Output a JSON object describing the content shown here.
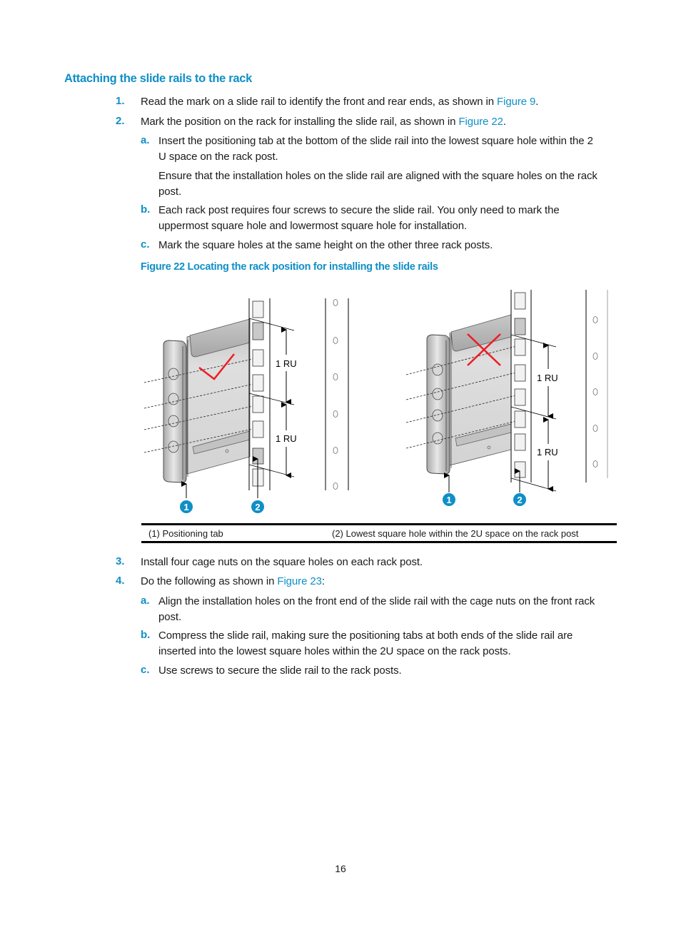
{
  "section": {
    "heading": "Attaching the slide rails to the rack"
  },
  "steps": [
    {
      "num": "1.",
      "text_before": "Read the mark on a slide rail to identify the front and rear ends, as shown in ",
      "link": "Figure 9",
      "text_after": "."
    },
    {
      "num": "2.",
      "text_before": "Mark the position on the rack for installing the slide rail, as shown in ",
      "link": "Figure 22",
      "text_after": ".",
      "substeps": [
        {
          "letter": "a.",
          "lines": [
            "Insert the positioning tab at the bottom of the slide rail into the lowest square hole within the 2",
            "U space on the rack post."
          ],
          "note_lines": [
            "Ensure that the installation holes on the slide rail are aligned with the square holes on the rack",
            "post."
          ]
        },
        {
          "letter": "b.",
          "lines": [
            "Each rack post requires four screws to secure the slide rail. You only need to mark the",
            "uppermost square hole and lowermost square hole for installation."
          ]
        },
        {
          "letter": "c.",
          "lines": [
            "Mark the square holes at the same height on the other three rack posts."
          ]
        }
      ]
    },
    {
      "num": "3.",
      "text": "Install four cage nuts on the square holes on each rack post."
    },
    {
      "num": "4.",
      "text_before": "Do the following as shown in ",
      "link": "Figure 23",
      "text_after": ":",
      "substeps": [
        {
          "letter": "a.",
          "lines": [
            "Align the installation holes on the front end of the slide rail with the cage nuts on the front rack",
            "post."
          ]
        },
        {
          "letter": "b.",
          "lines": [
            "Compress the slide rail, making sure the positioning tabs at both ends of the slide rail are",
            "inserted into the lowest square holes within the 2U space on the rack posts."
          ]
        },
        {
          "letter": "c.",
          "lines": [
            "Use screws to secure the slide rail to the rack posts."
          ]
        }
      ]
    }
  ],
  "figure": {
    "caption": "Figure 22 Locating the rack position for installing the slide rails",
    "left_panel": {
      "mark": "correct (check mark)",
      "ru_labels": [
        "1 RU",
        "1 RU"
      ],
      "callouts": [
        "1",
        "2"
      ]
    },
    "right_panel": {
      "mark": "incorrect (cross mark)",
      "ru_labels": [
        "1 RU",
        "1 RU"
      ],
      "callouts": [
        "1",
        "2"
      ]
    },
    "legend": [
      "(1) Positioning tab",
      "(2) Lowest square hole within the 2U space on the rack post"
    ],
    "colors": {
      "callout": "#0f8fc6",
      "mark": "#ee1c24"
    }
  },
  "page_number": "16",
  "colors": {
    "accent": "#0f8fc6"
  }
}
